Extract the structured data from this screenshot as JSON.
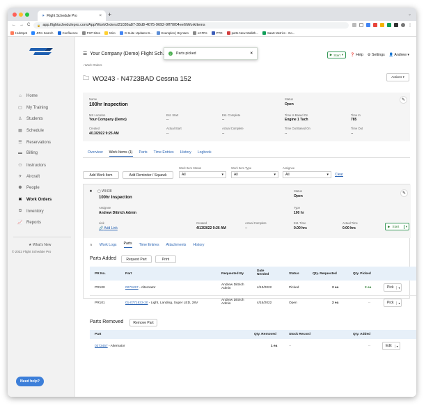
{
  "browser": {
    "tab_title": "Flight Schedule Pro",
    "url": "app.flightschedulepro.com/App/WorkOrders/21036a87-38d8-4075-9692-9ff70f04ee6/WorkItems"
  },
  "bookmarks": [
    "HubSpot",
    "JIRA Search",
    "Confluence",
    "FSP Sites",
    "Miro",
    "G Suite Updates B...",
    "Examples | Bryntum",
    "eCFRs",
    "PTO",
    "parts-New-Walkth...",
    "SaaS Metrics - Go..."
  ],
  "sidebar": {
    "items": [
      "Home",
      "My Training",
      "Students",
      "Schedule",
      "Reservations",
      "Billing",
      "Instructors",
      "Aircraft",
      "People",
      "Work Orders",
      "Inventory",
      "Reports"
    ],
    "whats_new": "★ What's New",
    "copyright": "© 2022 Flight Schedule Pro",
    "need_help": "Need help?"
  },
  "header": {
    "company": "Your Company (Demo) Flight Sch...",
    "toast": "Parts picked",
    "start": "Start",
    "help": "Help",
    "settings": "Settings",
    "user": "Andrew"
  },
  "wo": {
    "back": "‹ Work Orders",
    "title": "WO243 - N4723BAD Cessna 152",
    "actions": "Actions ▾"
  },
  "summary": {
    "name_l": "Name",
    "name": "100hr Inspection",
    "status_l": "Status",
    "status": "Open",
    "loc_l": "MX Location",
    "loc": "Your Company (Demo)",
    "est_start_l": "Est. Start",
    "est_start": "--",
    "est_comp_l": "Est. Complete",
    "est_comp": "--",
    "due_based_l": "Time Is Based On",
    "due_based": "Engine 1 Tach",
    "time_in_l": "Time In",
    "time_in": "785",
    "created_l": "Created",
    "created": "4/13/2022 9:25 AM",
    "act_start_l": "Actual Start",
    "act_start": "--",
    "act_comp_l": "Actual Complete",
    "act_comp": "--",
    "time_out_based_l": "Time Out Based On",
    "time_out_based": "--",
    "time_out_l": "Time Out",
    "time_out": "--"
  },
  "tabs": [
    "Overview",
    "Work Items (1)",
    "Parts",
    "Time Entries",
    "History",
    "Logbook"
  ],
  "filters": {
    "add_work_item": "Add Work Item",
    "add_reminder": "Add Reminder / Squawk",
    "status_l": "Work Item Status",
    "status": "All",
    "type_l": "Work Item Type",
    "type": "All",
    "assignee_l": "Assignee",
    "assignee": "All",
    "clear": "Clear"
  },
  "item": {
    "id": "WI438",
    "name": "100hr Inspection",
    "status_l": "Status",
    "status": "Open",
    "assignee_l": "Assignee",
    "assignee": "Andrew Dittrich Admin",
    "type_l": "Type",
    "type": "100 hr",
    "link_l": "Link",
    "link": "Add Link",
    "created_l": "Created",
    "created": "4/13/2022 9:26 AM",
    "act_comp_l": "Actual Complete",
    "act_comp": "--",
    "est_time_l": "Est. Time",
    "est_time": "0.00 hrs",
    "act_time_l": "Actual Time",
    "act_time": "0.00 hrs",
    "start": "Start"
  },
  "subtabs": [
    "Work Logs",
    "Parts",
    "Time Entries",
    "Attachments",
    "History"
  ],
  "parts_added": {
    "title": "Parts Added",
    "request": "Request Part",
    "print": "Print",
    "headers": [
      "PR No.",
      "Part",
      "Requested By",
      "Date Needed",
      "Status",
      "Qty. Requested",
      "Qty. Picked"
    ],
    "rows": [
      {
        "pr": "PR100",
        "part_no": "0273457",
        "part_desc": " - Alternator",
        "by": "Andrew Dittrich Admin",
        "date": "4/13/2022",
        "status": "Picked",
        "qty_req": "2 ea",
        "qty_pick": "2 ea",
        "btn": "Pick"
      },
      {
        "pr": "PR101",
        "part_no": "01-0771833-20",
        "part_desc": " - Light, Landing, Super LED, 28V",
        "by": "Andrew Dittrich Admin",
        "date": "4/15/2022",
        "status": "Open",
        "qty_req": "2 ea",
        "qty_pick": "--",
        "btn": "Pick"
      }
    ]
  },
  "parts_removed": {
    "title": "Parts Removed",
    "remove": "Remove Part",
    "headers": [
      "Part",
      "Qty. Removed",
      "Stock Record",
      "Qty. Added"
    ],
    "rows": [
      {
        "part_no": "0273457",
        "part_desc": " - Alternator",
        "qty_rem": "1 ea",
        "stock": "--",
        "qty_add": "--",
        "btn": "Edit"
      }
    ]
  },
  "colors": {
    "accent": "#2a64b3",
    "header_bg": "#e7f0f9",
    "success": "#2e7d32"
  }
}
